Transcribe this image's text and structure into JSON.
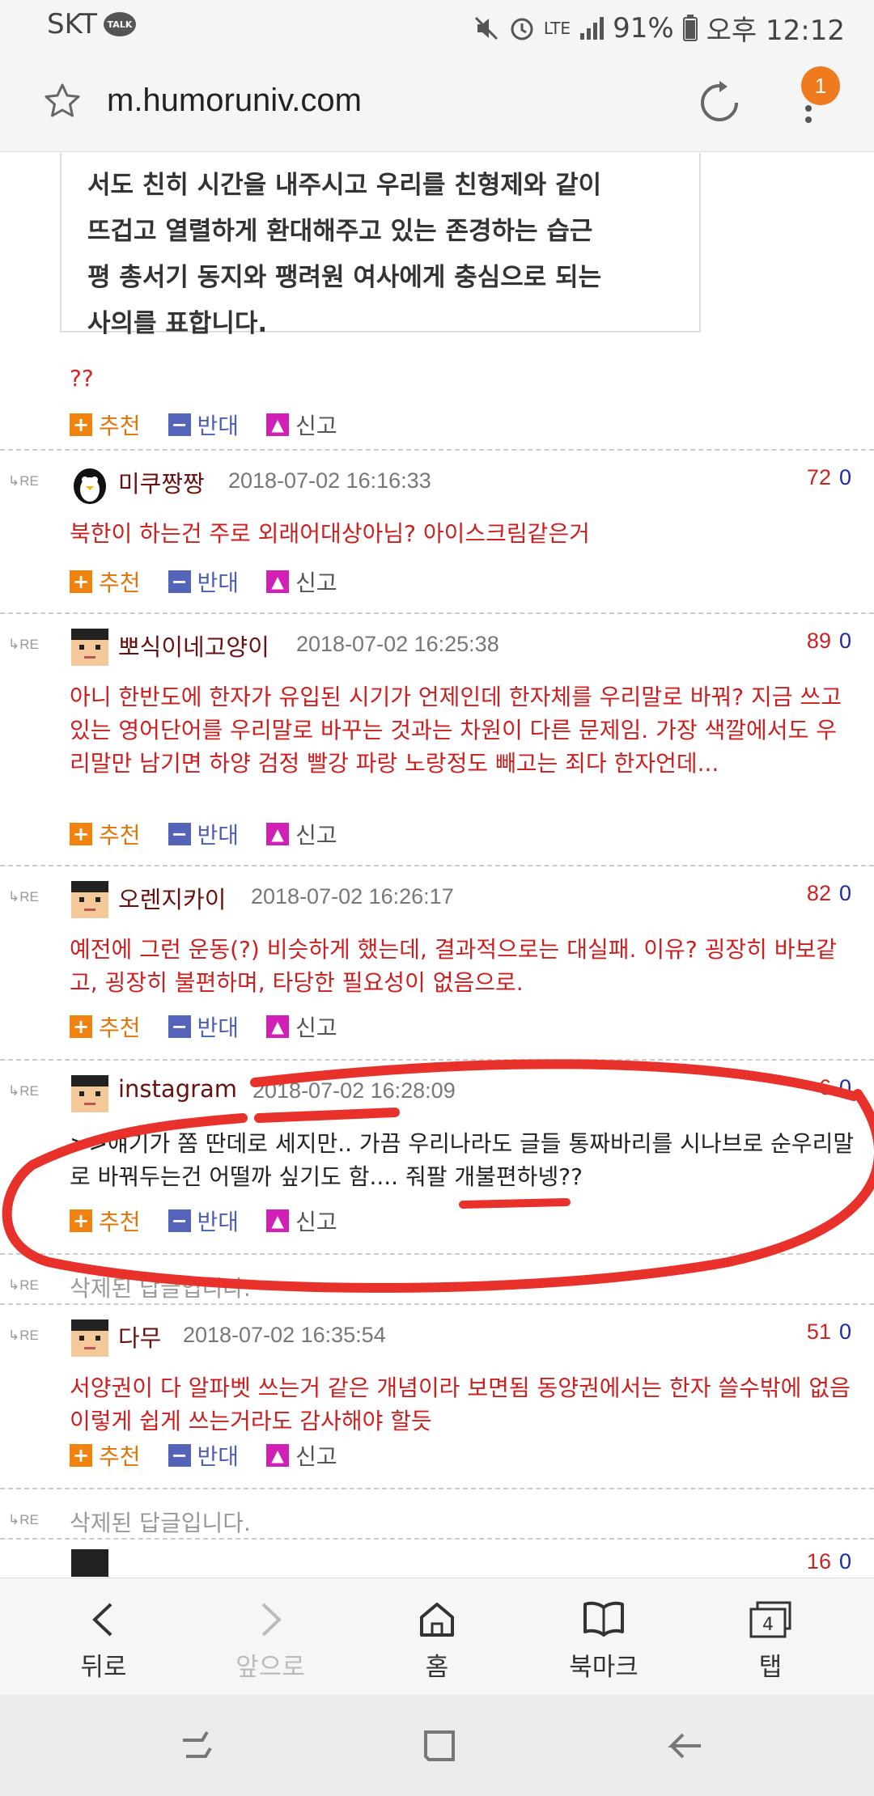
{
  "status": {
    "carrier": "SKT",
    "talk": "TALK",
    "lte": "LTE",
    "battery": "91%",
    "time": "오후 12:12"
  },
  "browser": {
    "url": "m.humoruniv.com",
    "badge": "1"
  },
  "post": {
    "quote_lines": [
      "서도 친히 시간을 내주시고 우리를 친형제와 같이",
      "뜨겁고 열렬하게 환대해주고 있는 존경하는 습근",
      "평 총서기 동지와 팽려원 여사에게 충심으로 되는",
      "사의를 표합니다."
    ],
    "comment": "??",
    "recommend": "추천",
    "oppose": "반대",
    "report": "신고"
  },
  "comments": [
    {
      "re": "RE",
      "nick": "미쿠짱짱",
      "date": "2018-07-02 16:16:33",
      "up": "72",
      "down": "0",
      "text": "북한이 하는건 주로 외래어대상아님? 아이스크림같은거"
    },
    {
      "re": "RE",
      "nick": "뽀식이네고양이",
      "date": "2018-07-02 16:25:38",
      "up": "89",
      "down": "0",
      "text": "아니 한반도에 한자가 유입된 시기가 언제인데 한자체를 우리말로 바꿔? 지금 쓰고 있는 영어단어를 우리말로 바꾸는 것과는 차원이 다른 문제임. 가장 색깔에서도 우리말만 남기면 하양 검정 빨강 파랑 노랑정도 빼고는 죄다 한자언데..."
    },
    {
      "re": "RE",
      "nick": "오렌지카이",
      "date": "2018-07-02 16:26:17",
      "up": "82",
      "down": "0",
      "text": "예전에 그런 운동(?) 비슷하게 했는데, 결과적으로는 대실패. 이유? 굉장히 바보같고, 굉장히 불편하며, 타당한 필요성이 없음으로."
    },
    {
      "re": "RE",
      "nick": "instagram",
      "date": "2018-07-02 16:28:09",
      "up": "6",
      "down": "0",
      "text": ">>얘기가 쫌 딴데로 세지만.. 가끔 우리나라도 글들 통짜바리를 시나브로 순우리말로 바꿔두는건 어떨까 싶기도 함.... 줘팔 개불편하넹??"
    },
    {
      "re": "RE",
      "deleted": "삭제된 답글입니다."
    },
    {
      "re": "RE",
      "nick": "다무",
      "date": "2018-07-02 16:35:54",
      "up": "51",
      "down": "0",
      "text": "서양권이 다 알파벳 쓰는거 같은 개념이라 보면됨 동양권에서는 한자 쓸수밖에 없음 이렇게 쉽게 쓰는거라도 감사해야 할듯"
    },
    {
      "re": "RE",
      "deleted": "삭제된 답글입니다."
    },
    {
      "up": "16",
      "down": "0"
    }
  ],
  "nav": {
    "back": "뒤로",
    "forward": "앞으로",
    "home": "홈",
    "bookmark": "북마크",
    "tabs": "탭",
    "tab_count": "4"
  },
  "colors": {
    "accent_orange": "#f07a1e",
    "comment_red": "#cc1f1f",
    "annotation_red": "#e8312b"
  }
}
